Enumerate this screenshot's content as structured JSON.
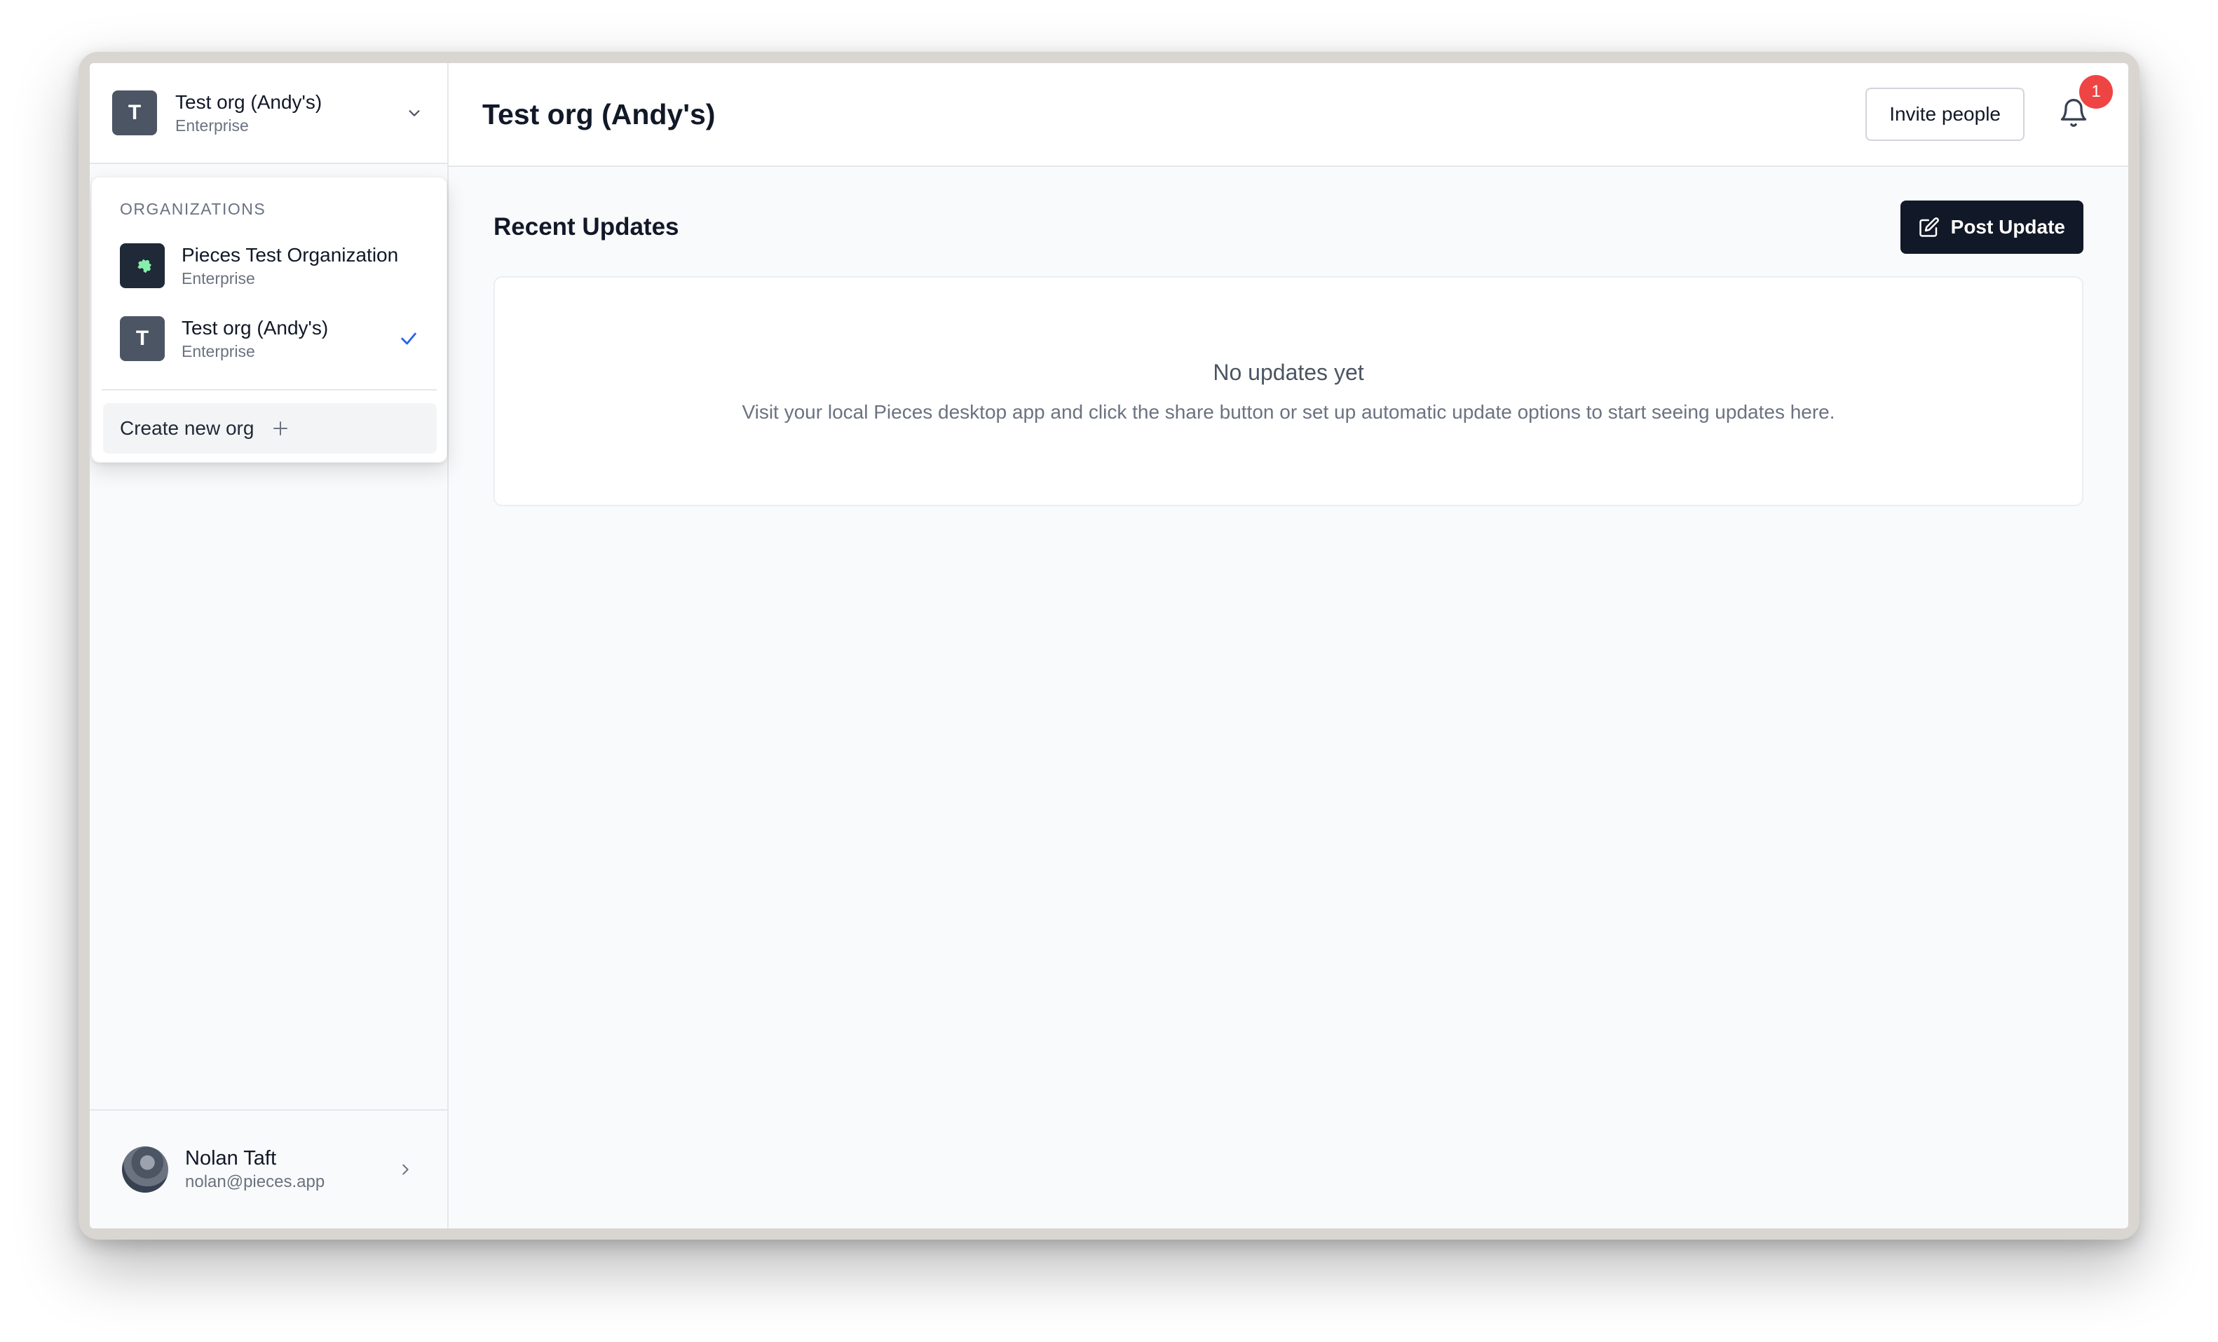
{
  "current_org": {
    "initial": "T",
    "name": "Test org (Andy's)",
    "plan": "Enterprise"
  },
  "dropdown": {
    "heading": "ORGANIZATIONS",
    "items": [
      {
        "name": "Pieces Test Organization",
        "plan": "Enterprise",
        "icon": "puzzle-piece-icon",
        "selected": false
      },
      {
        "name": "Test org (Andy's)",
        "plan": "Enterprise",
        "initial": "T",
        "selected": true
      }
    ],
    "create_label": "Create new org"
  },
  "user": {
    "name": "Nolan Taft",
    "email": "nolan@pieces.app"
  },
  "header": {
    "title": "Test org (Andy's)",
    "invite_label": "Invite people",
    "notification_count": "1"
  },
  "updates": {
    "title": "Recent Updates",
    "post_label": "Post Update",
    "empty_title": "No updates yet",
    "empty_message": "Visit your local Pieces desktop app and click the share button or set up automatic update options to start seeing updates here."
  },
  "colors": {
    "accent": "#111827",
    "badge": "#ef4444",
    "check": "#2563eb"
  }
}
